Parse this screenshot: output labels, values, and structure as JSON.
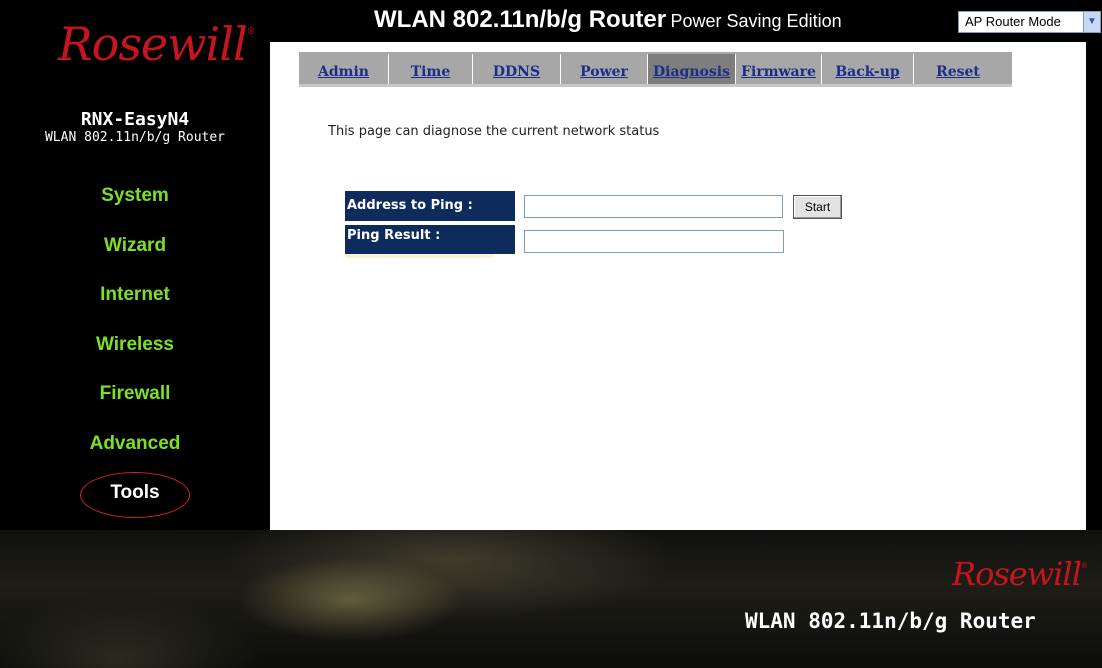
{
  "brand": {
    "logo_text": "Rosewill",
    "reg_mark": "®"
  },
  "header": {
    "title_main": "WLAN 802.11n/b/g Router",
    "title_sub": "Power Saving Edition",
    "mode_select_value": "AP Router Mode"
  },
  "model": {
    "name": "RNX-EasyN4",
    "description": "WLAN 802.11n/b/g Router"
  },
  "sidebar": {
    "items": [
      {
        "label": "System"
      },
      {
        "label": "Wizard"
      },
      {
        "label": "Internet"
      },
      {
        "label": "Wireless"
      },
      {
        "label": "Firewall"
      },
      {
        "label": "Advanced"
      },
      {
        "label": "Tools"
      }
    ],
    "active": "Tools"
  },
  "tabs": [
    {
      "label": "Admin"
    },
    {
      "label": "Time"
    },
    {
      "label": "DDNS"
    },
    {
      "label": "Power"
    },
    {
      "label": "Diagnosis"
    },
    {
      "label": "Firmware"
    },
    {
      "label": "Back-up"
    },
    {
      "label": "Reset"
    }
  ],
  "active_tab": "Diagnosis",
  "main": {
    "description": "This page can diagnose the current network status",
    "ping_label": "Address to Ping :",
    "ping_value": "",
    "start_button": "Start",
    "result_label": "Ping Result :",
    "result_value": ""
  },
  "footer": {
    "title": "WLAN 802.11n/b/g Router"
  },
  "colors": {
    "nav_green": "#7be02a",
    "label_navy": "#0e2b5e",
    "tab_link_blue": "#1b2e88",
    "logo_red": "#c8141e"
  }
}
